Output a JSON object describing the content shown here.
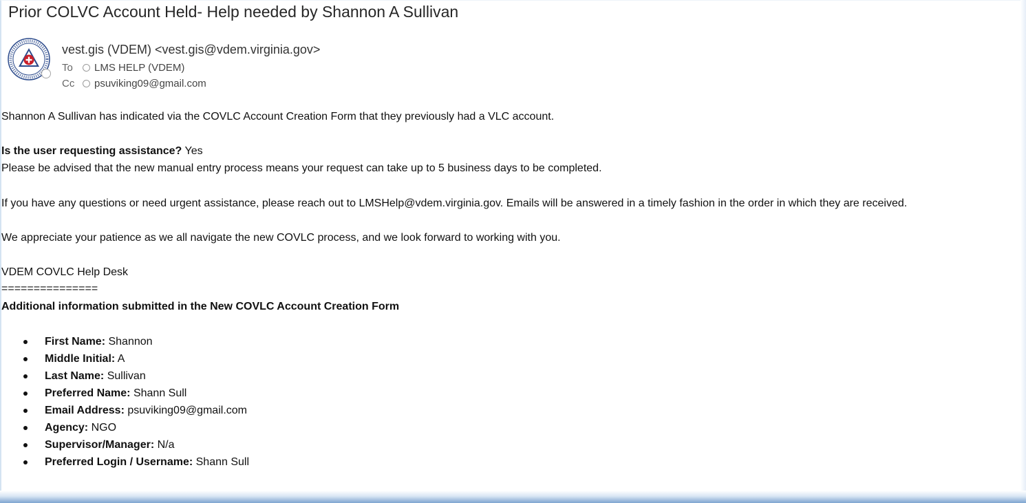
{
  "email": {
    "subject": "Prior COLVC Account Held- Help needed by Shannon  A Sullivan",
    "sender": "vest.gis (VDEM) <vest.gis@vdem.virginia.gov>",
    "to_label": "To",
    "to_value": "LMS HELP (VDEM)",
    "cc_label": "Cc",
    "cc_value": "psuviking09@gmail.com",
    "avatar_icon": "vdem-seal-icon"
  },
  "body": {
    "intro": "Shannon A Sullivan has indicated via the COVLC Account Creation Form that they previously had a VLC account.",
    "assist_label": "Is the user requesting assistance?",
    "assist_value": " Yes",
    "advisory": "Please be advised that the new manual entry process means your request can take up to 5 business days to be completed.",
    "questions": "If you have any questions or need urgent assistance, please reach out to LMSHelp@vdem.virginia.gov. Emails will be answered in a timely fashion in the order in which they are received.",
    "appreciate": "We appreciate your patience as we all navigate the new COVLC process, and we look forward to working with you.",
    "signature": "VDEM COVLC Help Desk",
    "separator": "===============",
    "additional_header": "Additional information submitted in the New COVLC Account Creation Form"
  },
  "fields": [
    {
      "label": "First Name:",
      "value": " Shannon"
    },
    {
      "label": "Middle Initial:",
      "value": " A"
    },
    {
      "label": "Last Name:",
      "value": " Sullivan"
    },
    {
      "label": "Preferred Name:",
      "value": " Shann Sull"
    },
    {
      "label": "Email Address:",
      "value": " psuviking09@gmail.com"
    },
    {
      "label": "Agency:",
      "value": " NGO"
    },
    {
      "label": "Supervisor/Manager:",
      "value": " N/a"
    },
    {
      "label": "Preferred Login / Username:",
      "value": " Shann Sull"
    }
  ],
  "colors": {
    "seal_blue": "#2b4a8b",
    "seal_red": "#c8202a",
    "frame_blue": "#7fa5d0"
  }
}
